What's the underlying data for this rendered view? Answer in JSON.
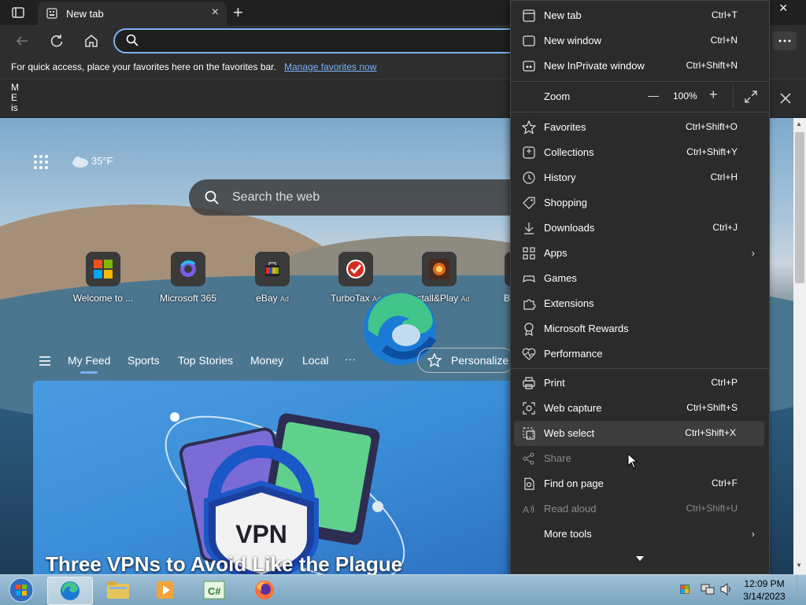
{
  "browser": {
    "tab_title": "New tab",
    "new_tab_button": "+",
    "close_window": "×",
    "favorites_bar_text": "For quick access, place your favorites here on the favorites bar.",
    "favorites_bar_link": "Manage favorites now",
    "info_vertical_text": [
      "M",
      "E",
      "is"
    ]
  },
  "newtab": {
    "weather": "35°F",
    "search_placeholder": "Search the web",
    "shortcuts": [
      {
        "label": "Welcome to ...",
        "ad": ""
      },
      {
        "label": "Microsoft 365",
        "ad": ""
      },
      {
        "label": "eBay",
        "ad": "Ad"
      },
      {
        "label": "TurboTax",
        "ad": "Ad"
      },
      {
        "label": "Install&Play",
        "ad": "Ad"
      },
      {
        "label": "B",
        "ad": ""
      }
    ],
    "feed_tabs": [
      "My Feed",
      "Sports",
      "Top Stories",
      "Money",
      "Local",
      "···"
    ],
    "personalize": "Personalize",
    "card_title": "Three VPNs to Avoid Like the Plague",
    "card_badge": "VPN"
  },
  "menu": {
    "items": [
      {
        "label": "New tab",
        "shortcut": "Ctrl+T",
        "icon": "new-tab-icon"
      },
      {
        "label": "New window",
        "shortcut": "Ctrl+N",
        "icon": "window-icon"
      },
      {
        "label": "New InPrivate window",
        "shortcut": "Ctrl+Shift+N",
        "icon": "inprivate-icon"
      },
      {
        "label": "Favorites",
        "shortcut": "Ctrl+Shift+O",
        "icon": "star-icon"
      },
      {
        "label": "Collections",
        "shortcut": "Ctrl+Shift+Y",
        "icon": "collections-icon"
      },
      {
        "label": "History",
        "shortcut": "Ctrl+H",
        "icon": "history-icon"
      },
      {
        "label": "Shopping",
        "shortcut": "",
        "icon": "tag-icon"
      },
      {
        "label": "Downloads",
        "shortcut": "Ctrl+J",
        "icon": "download-icon"
      },
      {
        "label": "Apps",
        "shortcut": "",
        "icon": "apps-icon"
      },
      {
        "label": "Games",
        "shortcut": "",
        "icon": "games-icon"
      },
      {
        "label": "Extensions",
        "shortcut": "",
        "icon": "extensions-icon"
      },
      {
        "label": "Microsoft Rewards",
        "shortcut": "",
        "icon": "rewards-icon"
      },
      {
        "label": "Performance",
        "shortcut": "",
        "icon": "heartbeat-icon"
      },
      {
        "label": "Print",
        "shortcut": "Ctrl+P",
        "icon": "print-icon"
      },
      {
        "label": "Web capture",
        "shortcut": "Ctrl+Shift+S",
        "icon": "capture-icon"
      },
      {
        "label": "Web select",
        "shortcut": "Ctrl+Shift+X",
        "icon": "select-icon"
      },
      {
        "label": "Share",
        "shortcut": "",
        "icon": "share-icon"
      },
      {
        "label": "Find on page",
        "shortcut": "Ctrl+F",
        "icon": "find-icon"
      },
      {
        "label": "Read aloud",
        "shortcut": "Ctrl+Shift+U",
        "icon": "read-aloud-icon"
      },
      {
        "label": "More tools",
        "shortcut": "",
        "icon": "more-tools-icon"
      }
    ],
    "zoom_label": "Zoom",
    "zoom_value": "100%",
    "zoom_minus": "—",
    "zoom_plus": "+"
  },
  "taskbar": {
    "time": "12:09 PM",
    "date": "3/14/2023"
  }
}
